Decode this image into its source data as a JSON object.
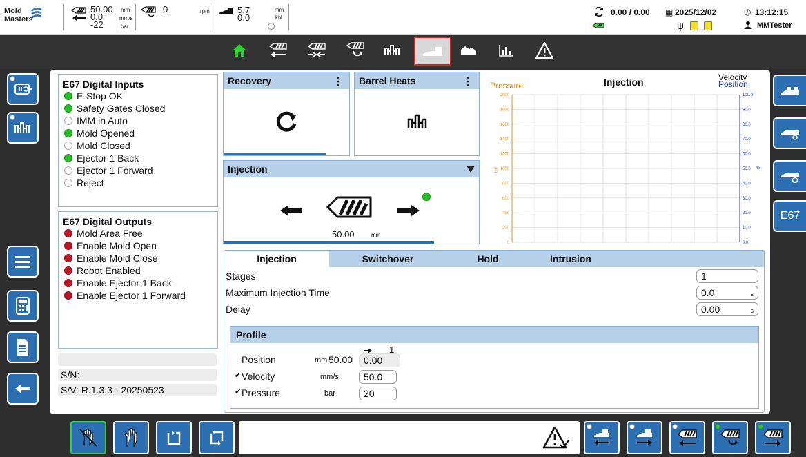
{
  "brand": {
    "line1": "Mold",
    "line2": "Masters"
  },
  "status": {
    "injection_value": "50.00",
    "injection_speed": "0.0",
    "injection_pressure": "-22",
    "units": {
      "mm": "mm",
      "mms": "mm/s",
      "bar": "bar",
      "rpm": "rpm",
      "kn": "kN"
    },
    "screw_rpm": "0",
    "clamp_pos": "5.7",
    "clamp_force": "0.0",
    "cycle": "0.00 / 0.00",
    "date": "2025/12/02",
    "time": "13:12:15",
    "user": "MMTester"
  },
  "digital_inputs": {
    "title": "E67 Digital Inputs",
    "items": [
      {
        "label": "E-Stop OK",
        "state": "green"
      },
      {
        "label": "Safety Gates Closed",
        "state": "green"
      },
      {
        "label": "IMM in Auto",
        "state": "off"
      },
      {
        "label": "Mold Opened",
        "state": "green"
      },
      {
        "label": "Mold Closed",
        "state": "off"
      },
      {
        "label": "Ejector 1 Back",
        "state": "green"
      },
      {
        "label": "Ejector 1 Forward",
        "state": "off"
      },
      {
        "label": "Reject",
        "state": "off"
      }
    ]
  },
  "digital_outputs": {
    "title": "E67 Digital Outputs",
    "items": [
      {
        "label": "Mold Area Free",
        "state": "red"
      },
      {
        "label": "Enable Mold Open",
        "state": "red"
      },
      {
        "label": "Enable Mold Close",
        "state": "red"
      },
      {
        "label": "Robot Enabled",
        "state": "red"
      },
      {
        "label": "Enable Ejector 1 Back",
        "state": "red"
      },
      {
        "label": "Enable Ejector 1 Forward",
        "state": "red"
      }
    ]
  },
  "device_info": {
    "serial": "S/N:",
    "version": "S/V: R.1.3.3 - 20250523"
  },
  "cards": {
    "recovery": "Recovery",
    "barrel_heats": "Barrel Heats",
    "injection": "Injection",
    "injection_position": "50.00",
    "injection_unit": "mm"
  },
  "tabs": [
    "Injection",
    "Switchover",
    "Hold",
    "Intrusion"
  ],
  "params": [
    {
      "label": "Stages",
      "value": "1",
      "unit": ""
    },
    {
      "label": "Maximum Injection Time",
      "value": "0.0",
      "unit": "s"
    },
    {
      "label": "Delay",
      "value": "0.00",
      "unit": "s"
    }
  ],
  "profile": {
    "title": "Profile",
    "stage_label": "1",
    "position": {
      "label": "Position",
      "unit": "mm",
      "start": "50.00",
      "value": "0.00"
    },
    "velocity": {
      "label": "Velocity",
      "unit": "mm/s",
      "value": "50.0"
    },
    "pressure": {
      "label": "Pressure",
      "unit": "bar",
      "value": "20"
    }
  },
  "chart": {
    "title": "Injection",
    "left_label": "Pressure",
    "left_unit": "bar",
    "right_label_1": "Velocity",
    "right_label_2": "Position",
    "right_unit": "%",
    "left_ticks": [
      "2000",
      "1800",
      "1600",
      "1400",
      "1200",
      "1000",
      "800",
      "600",
      "400",
      "200",
      "0"
    ],
    "right_ticks": [
      "100.0",
      "90.0",
      "80.0",
      "70.0",
      "60.0",
      "50.0",
      "40.0",
      "30.0",
      "20.0",
      "10.0",
      "0.0"
    ],
    "colors": {
      "pressure": "#f08a1c",
      "velocity": "#1f3ad0",
      "position": "#1f3ad0"
    }
  },
  "right_side": {
    "e67_label": "E67"
  },
  "colors": {
    "accent": "#2d6fb3",
    "header": "#b8d1ea",
    "led_green": "#22c122",
    "led_red": "#c11425",
    "selected_border": "#dd2222"
  }
}
